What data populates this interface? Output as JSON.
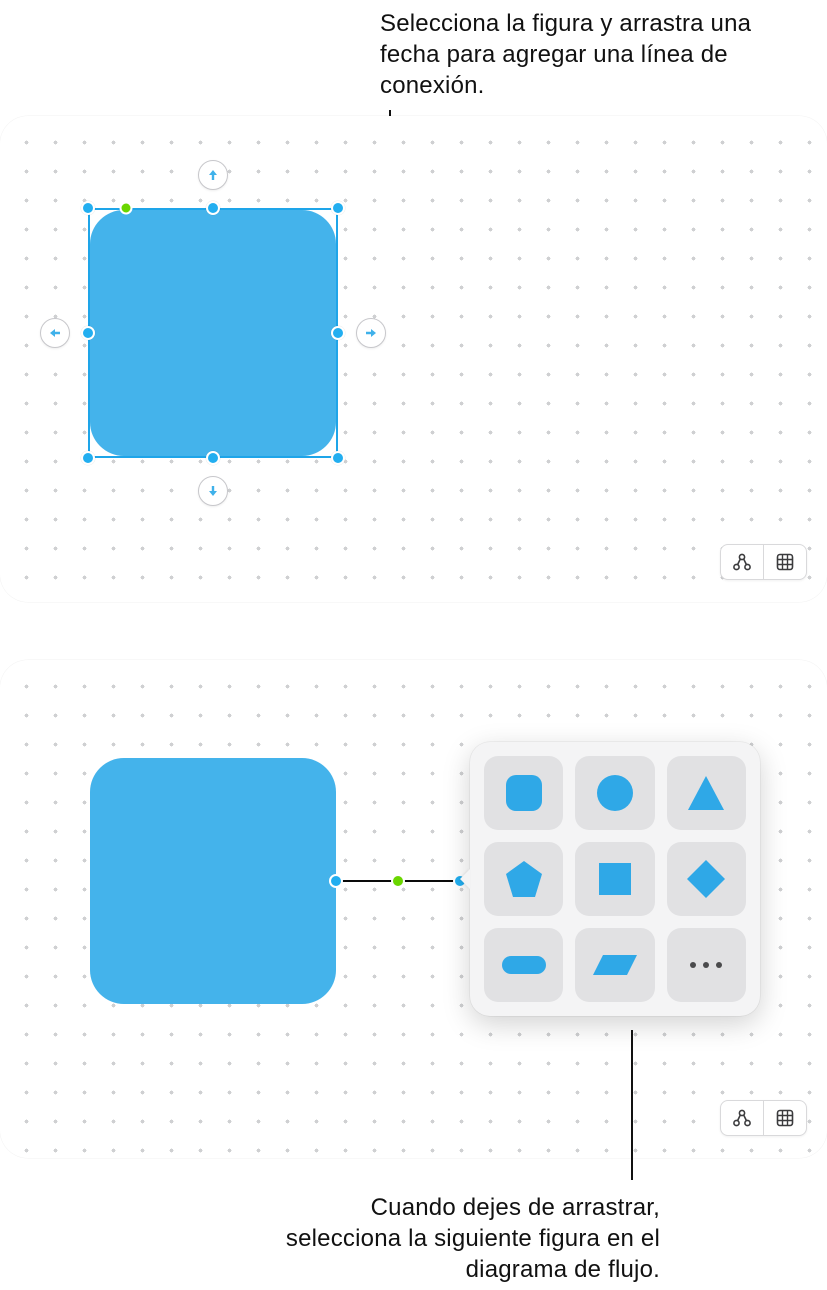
{
  "callouts": {
    "top": "Selecciona la figura y arrastra una fecha para agregar una línea de conexión.",
    "bottom": "Cuando dejes de arrastrar, selecciona la siguiente figura en el diagrama de flujo."
  },
  "colors": {
    "shape_fill": "#44b3eb",
    "selection": "#1ea5e9",
    "rotation_handle": "#6ad600",
    "dot_grid": "#cfd0d2",
    "popover_bg": "#f4f4f5",
    "popover_cell": "#e1e1e3"
  },
  "board1": {
    "shape": {
      "type": "rounded-square",
      "selected": true
    },
    "connection_arrows": [
      "up",
      "down",
      "left",
      "right"
    ],
    "toolbar": {
      "left_icon": "diagram-mode-icon",
      "right_icon": "grid-icon"
    }
  },
  "board2": {
    "shape": {
      "type": "rounded-square",
      "selected": false
    },
    "connector": {
      "present": true,
      "handles": [
        "start",
        "mid",
        "end"
      ]
    },
    "popover_shapes": [
      "rounded-square",
      "circle",
      "triangle",
      "pentagon",
      "square",
      "diamond",
      "pill",
      "parallelogram",
      "more"
    ],
    "toolbar": {
      "left_icon": "diagram-mode-icon",
      "right_icon": "grid-icon"
    }
  }
}
